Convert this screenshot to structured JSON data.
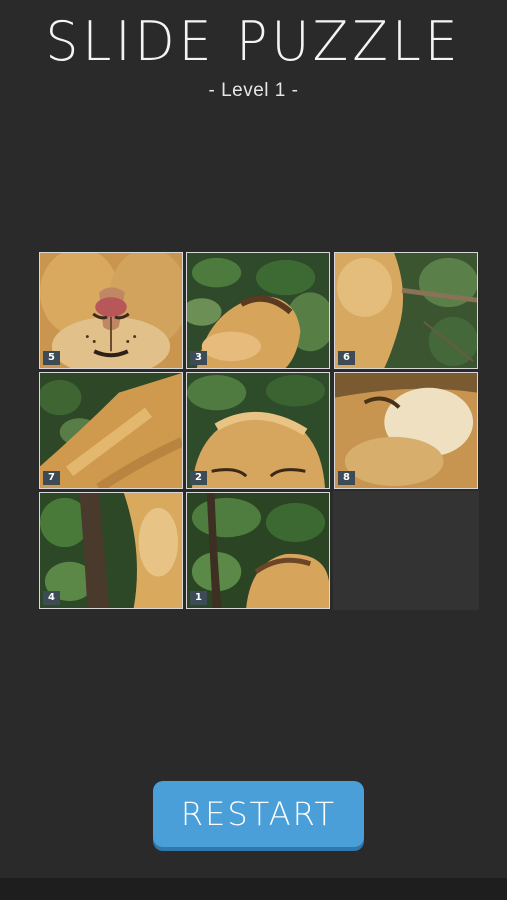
{
  "header": {
    "title": "SLIDE PUZZLE",
    "level": "- Level 1 -"
  },
  "board": {
    "columns": 3,
    "rows": 3,
    "tiles": [
      {
        "number": "5",
        "row": 0,
        "col": 0,
        "depicts": "lion nose"
      },
      {
        "number": "3",
        "row": 0,
        "col": 1,
        "depicts": "lion ear and leaves"
      },
      {
        "number": "6",
        "row": 0,
        "col": 2,
        "depicts": "lion fur and branch"
      },
      {
        "number": "7",
        "row": 1,
        "col": 0,
        "depicts": "lion back and leaves"
      },
      {
        "number": "2",
        "row": 1,
        "col": 1,
        "depicts": "lion head top"
      },
      {
        "number": "8",
        "row": 1,
        "col": 2,
        "depicts": "lion ruff"
      },
      {
        "number": "4",
        "row": 2,
        "col": 0,
        "depicts": "tree trunk and fur"
      },
      {
        "number": "1",
        "row": 2,
        "col": 1,
        "depicts": "leaves and lion ear"
      }
    ],
    "empty": {
      "row": 2,
      "col": 2
    }
  },
  "buttons": {
    "restart": "RESTART"
  },
  "colors": {
    "background": "#2a2a2a",
    "button": "#4a9fd8",
    "label_bg": "#3c4b55"
  }
}
